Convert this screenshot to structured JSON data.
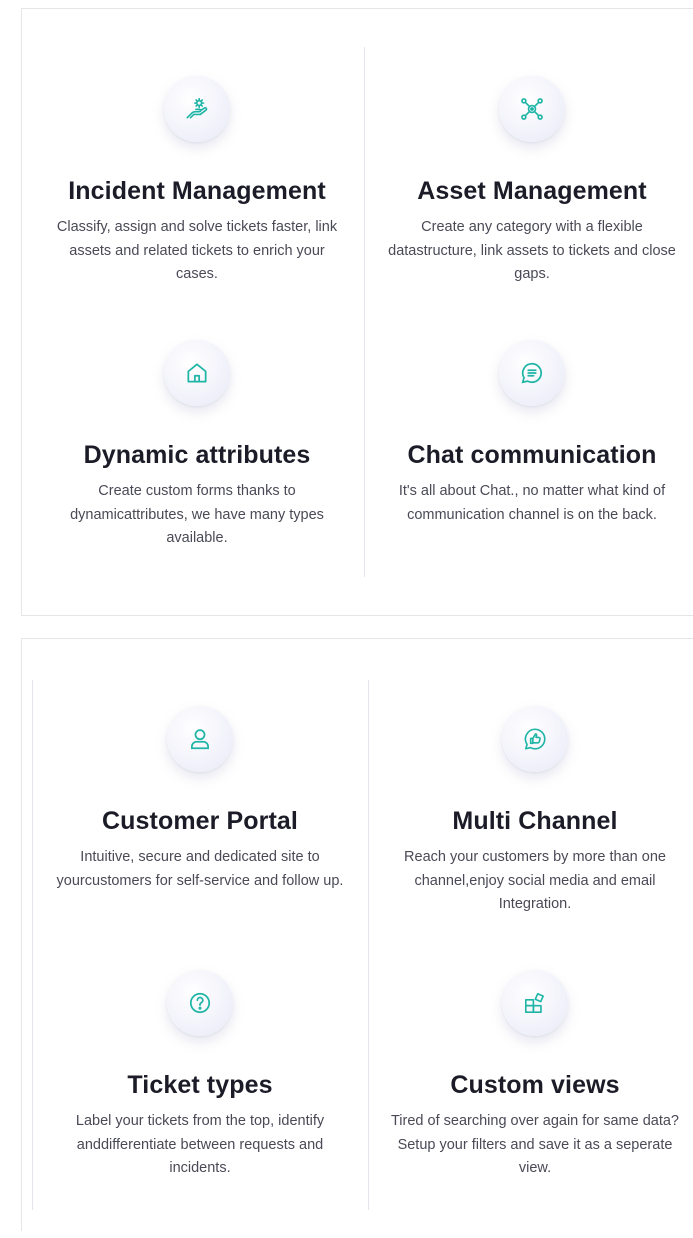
{
  "sections": [
    {
      "features": [
        {
          "title": "Incident Management",
          "desc": "Classify, assign and solve tickets faster, link assets and related tickets to enrich your cases.",
          "icon": "hand-gear-icon"
        },
        {
          "title": "Asset Management",
          "desc": "Create any category with a flexible datastructure, link assets to tickets and close gaps.",
          "icon": "network-nodes-icon"
        },
        {
          "title": "Dynamic attributes",
          "desc": "Create custom forms thanks to dynamicattributes, we have many types available.",
          "icon": "home-icon"
        },
        {
          "title": "Chat communication",
          "desc": "It's all about Chat., no matter what kind of communication channel is on the back.",
          "icon": "chat-bubble-icon"
        }
      ]
    },
    {
      "features": [
        {
          "title": "Customer Portal",
          "desc": "Intuitive, secure and dedicated site to yourcustomers for self-service and follow up.",
          "icon": "user-icon"
        },
        {
          "title": "Multi Channel",
          "desc": "Reach your customers by more than one channel,enjoy social media and email Integration.",
          "icon": "thumbs-up-chat-icon"
        },
        {
          "title": "Ticket types",
          "desc": "Label your tickets from the top, identify anddifferentiate between requests and incidents.",
          "icon": "question-circle-icon"
        },
        {
          "title": "Custom views",
          "desc": "Tired of searching over again for same data? Setup your filters and save it as a seperate view.",
          "icon": "grid-shapes-icon"
        }
      ]
    }
  ],
  "colors": {
    "accent": "#1fb5a6",
    "title": "#1c1c28",
    "text": "#4a4a57",
    "border": "#e4e6ea"
  }
}
